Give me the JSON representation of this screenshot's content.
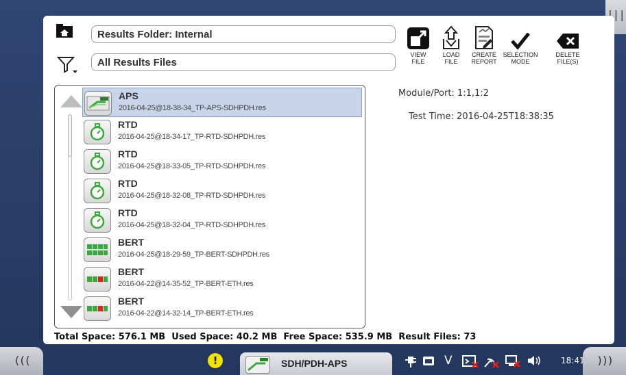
{
  "side_tab_top": {
    "label": "|||"
  },
  "toolbar": {
    "folder_path": "Results Folder: Internal",
    "filter_value": "All Results Files",
    "buttons": [
      {
        "id": "view-file",
        "label": "VIEW\nFILE",
        "icon": "view-file-icon"
      },
      {
        "id": "load-file",
        "label": "LOAD\nFILE",
        "icon": "load-file-icon"
      },
      {
        "id": "create-report",
        "label": "CREATE\nREPORT",
        "icon": "create-report-icon"
      },
      {
        "id": "selection-mode",
        "label": "SELECTION\nMODE",
        "icon": "checkmark-icon"
      },
      {
        "id": "delete-files",
        "label": "DELETE\nFILE(S)",
        "icon": "delete-icon"
      }
    ]
  },
  "files": [
    {
      "name": "APS",
      "file": "2016-04-25@18-38-34_TP-APS-SDHPDH.res",
      "icon": "aps-test-icon",
      "selected": true
    },
    {
      "name": "RTD",
      "file": "2016-04-25@18-34-17_TP-RTD-SDHPDH.res",
      "icon": "stopwatch-icon",
      "selected": false
    },
    {
      "name": "RTD",
      "file": "2016-04-25@18-33-05_TP-RTD-SDHPDH.res",
      "icon": "stopwatch-icon",
      "selected": false
    },
    {
      "name": "RTD",
      "file": "2016-04-25@18-32-08_TP-RTD-SDHPDH.res",
      "icon": "stopwatch-icon",
      "selected": false
    },
    {
      "name": "RTD",
      "file": "2016-04-25@18-32-04_TP-RTD-SDHPDH.res",
      "icon": "stopwatch-icon",
      "selected": false
    },
    {
      "name": "BERT",
      "file": "2016-04-25@18-29-59_TP-BERT-SDHPDH.res",
      "icon": "bert-green-icon",
      "selected": false
    },
    {
      "name": "BERT",
      "file": "2016-04-22@14-35-52_TP-BERT-ETH.res",
      "icon": "bert-red-icon",
      "selected": false
    },
    {
      "name": "BERT",
      "file": "2016-04-22@14-32-14_TP-BERT-ETH.res",
      "icon": "bert-red-icon",
      "selected": false
    }
  ],
  "details": {
    "module_port": "Module/Port: 1:1,1:2",
    "test_time": "Test Time: 2016-04-25T18:38:35"
  },
  "storage": {
    "summary": "Total Space: 576.1 MB  Used Space: 40.2 MB  Free Space: 535.9 MB  Result Files: 73"
  },
  "taskbar": {
    "left_nav": "(((",
    "right_nav": ")))",
    "warning": "!",
    "app_tab_label": "SDH/PDH-APS",
    "clock": "18:41",
    "tray_icons": [
      "power-plug-icon",
      "camera-icon",
      "v-icon",
      "terminal-icon",
      "network-disabled-icon",
      "display-disabled-icon",
      "speaker-icon"
    ]
  },
  "colors": {
    "background": "#2a3f6a",
    "selected_row": "#c7d4ea",
    "green_accent": "#3aa83a",
    "red_x": "#e02020"
  }
}
